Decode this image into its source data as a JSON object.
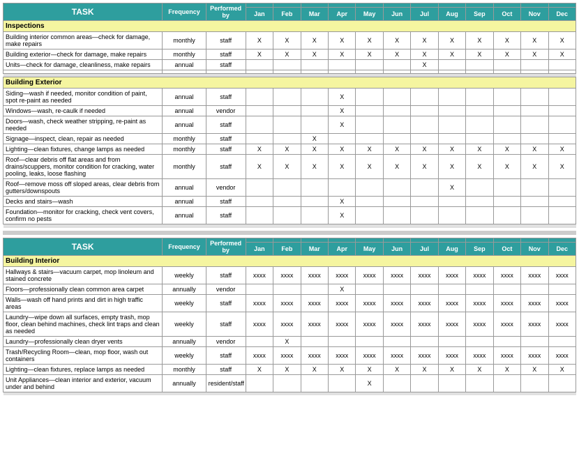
{
  "table1": {
    "headers": {
      "task": "TASK",
      "frequency": "Frequency",
      "performed_by": "Performed by",
      "months": [
        "Jan",
        "Feb",
        "Mar",
        "Apr",
        "May",
        "Jun",
        "Jul",
        "Aug",
        "Sep",
        "Oct",
        "Nov",
        "Dec"
      ]
    },
    "sections": [
      {
        "name": "Inspections",
        "rows": [
          {
            "task": "Building interior common areas—check for damage, make repairs",
            "frequency": "monthly",
            "performed_by": "staff",
            "marks": [
              "X",
              "X",
              "X",
              "X",
              "X",
              "X",
              "X",
              "X",
              "X",
              "X",
              "X",
              "X"
            ]
          },
          {
            "task": "Building exterior—check for damage, make repairs",
            "frequency": "monthly",
            "performed_by": "staff",
            "marks": [
              "X",
              "X",
              "X",
              "X",
              "X",
              "X",
              "X",
              "X",
              "X",
              "X",
              "X",
              "X"
            ]
          },
          {
            "task": "Units—check for damage, cleanliness, make repairs",
            "frequency": "annual",
            "performed_by": "staff",
            "marks": [
              "",
              "",
              "",
              "",
              "",
              "",
              "X",
              "",
              "",
              "",
              "",
              ""
            ]
          },
          {
            "task": "",
            "frequency": "",
            "performed_by": "",
            "marks": [
              "",
              "",
              "",
              "",
              "",
              "",
              "",
              "",
              "",
              "",
              "",
              ""
            ]
          }
        ]
      },
      {
        "name": "Building Exterior",
        "rows": [
          {
            "task": "Siding—wash if needed, monitor condition of paint, spot re-paint as needed",
            "frequency": "annual",
            "performed_by": "staff",
            "marks": [
              "",
              "",
              "",
              "X",
              "",
              "",
              "",
              "",
              "",
              "",
              "",
              ""
            ]
          },
          {
            "task": "Windows—wash, re-caulk if needed",
            "frequency": "annual",
            "performed_by": "vendor",
            "marks": [
              "",
              "",
              "",
              "X",
              "",
              "",
              "",
              "",
              "",
              "",
              "",
              ""
            ]
          },
          {
            "task": "Doors—wash, check weather stripping, re-paint as needed",
            "frequency": "annual",
            "performed_by": "staff",
            "marks": [
              "",
              "",
              "",
              "X",
              "",
              "",
              "",
              "",
              "",
              "",
              "",
              ""
            ]
          },
          {
            "task": "Signage—inspect, clean, repair as needed",
            "frequency": "monthly",
            "performed_by": "staff",
            "marks": [
              "",
              "",
              "X",
              "",
              "",
              "",
              "",
              "",
              "",
              "",
              "",
              ""
            ]
          },
          {
            "task": "Lighting—clean fixtures, change lamps as needed",
            "frequency": "monthly",
            "performed_by": "staff",
            "marks": [
              "X",
              "X",
              "X",
              "X",
              "X",
              "X",
              "X",
              "X",
              "X",
              "X",
              "X",
              "X"
            ]
          },
          {
            "task": "Roof—clear debris off flat areas and from drains/scuppers, monitor condition for cracking, water pooling, leaks, loose flashing",
            "frequency": "monthly",
            "performed_by": "staff",
            "marks": [
              "X",
              "X",
              "X",
              "X",
              "X",
              "X",
              "X",
              "X",
              "X",
              "X",
              "X",
              "X"
            ]
          },
          {
            "task": "Roof—remove moss off sloped areas, clear debris from gutters/downspouts",
            "frequency": "annual",
            "performed_by": "vendor",
            "marks": [
              "",
              "",
              "",
              "",
              "",
              "",
              "",
              "X",
              "",
              "",
              "",
              ""
            ]
          },
          {
            "task": "Decks and stairs—wash",
            "frequency": "annual",
            "performed_by": "staff",
            "marks": [
              "",
              "",
              "",
              "X",
              "",
              "",
              "",
              "",
              "",
              "",
              "",
              ""
            ]
          },
          {
            "task": "Foundation—monitor for cracking, check vent covers, confirm no pests",
            "frequency": "annual",
            "performed_by": "staff",
            "marks": [
              "",
              "",
              "",
              "X",
              "",
              "",
              "",
              "",
              "",
              "",
              "",
              ""
            ]
          }
        ]
      }
    ]
  },
  "table2": {
    "headers": {
      "task": "TASK",
      "frequency": "Frequency",
      "performed_by": "Performed by",
      "months": [
        "Jan",
        "Feb",
        "Mar",
        "Apr",
        "May",
        "Jun",
        "Jul",
        "Aug",
        "Sep",
        "Oct",
        "Nov",
        "Dec"
      ]
    },
    "sections": [
      {
        "name": "Building Interior",
        "rows": [
          {
            "task": "Hallways & stairs—vacuum carpet, mop linoleum and stained concrete",
            "frequency": "weekly",
            "performed_by": "staff",
            "marks": [
              "xxxx",
              "xxxx",
              "xxxx",
              "xxxx",
              "xxxx",
              "xxxx",
              "xxxx",
              "xxxx",
              "xxxx",
              "xxxx",
              "xxxx",
              "xxxx"
            ]
          },
          {
            "task": "Floors—professionally clean common area carpet",
            "frequency": "annually",
            "performed_by": "vendor",
            "marks": [
              "",
              "",
              "",
              "X",
              "",
              "",
              "",
              "",
              "",
              "",
              "",
              ""
            ]
          },
          {
            "task": "Walls—wash off hand prints and dirt in high traffic areas",
            "frequency": "weekly",
            "performed_by": "staff",
            "marks": [
              "xxxx",
              "xxxx",
              "xxxx",
              "xxxx",
              "xxxx",
              "xxxx",
              "xxxx",
              "xxxx",
              "xxxx",
              "xxxx",
              "xxxx",
              "xxxx"
            ]
          },
          {
            "task": "Laundry—wipe down all surfaces, empty trash, mop floor, clean behind machines, check lint traps and clean as needed",
            "frequency": "weekly",
            "performed_by": "staff",
            "marks": [
              "xxxx",
              "xxxx",
              "xxxx",
              "xxxx",
              "xxxx",
              "xxxx",
              "xxxx",
              "xxxx",
              "xxxx",
              "xxxx",
              "xxxx",
              "xxxx"
            ]
          },
          {
            "task": "Laundry—professionally clean dryer vents",
            "frequency": "annually",
            "performed_by": "vendor",
            "marks": [
              "",
              "X",
              "",
              "",
              "",
              "",
              "",
              "",
              "",
              "",
              "",
              ""
            ]
          },
          {
            "task": "Trash/Recycling Room—clean, mop floor, wash out containers",
            "frequency": "weekly",
            "performed_by": "staff",
            "marks": [
              "xxxx",
              "xxxx",
              "xxxx",
              "xxxx",
              "xxxx",
              "xxxx",
              "xxxx",
              "xxxx",
              "xxxx",
              "xxxx",
              "xxxx",
              "xxxx"
            ]
          },
          {
            "task": "Lighting—clean fixtures, replace lamps as needed",
            "frequency": "monthly",
            "performed_by": "staff",
            "marks": [
              "X",
              "X",
              "X",
              "X",
              "X",
              "X",
              "X",
              "X",
              "X",
              "X",
              "X",
              "X"
            ]
          },
          {
            "task": "Unit Appliances—clean interior and exterior, vacuum under and behind",
            "frequency": "annually",
            "performed_by": "resident/staff",
            "marks": [
              "",
              "",
              "",
              "",
              "X",
              "",
              "",
              "",
              "",
              "",
              "",
              ""
            ]
          }
        ]
      }
    ]
  }
}
